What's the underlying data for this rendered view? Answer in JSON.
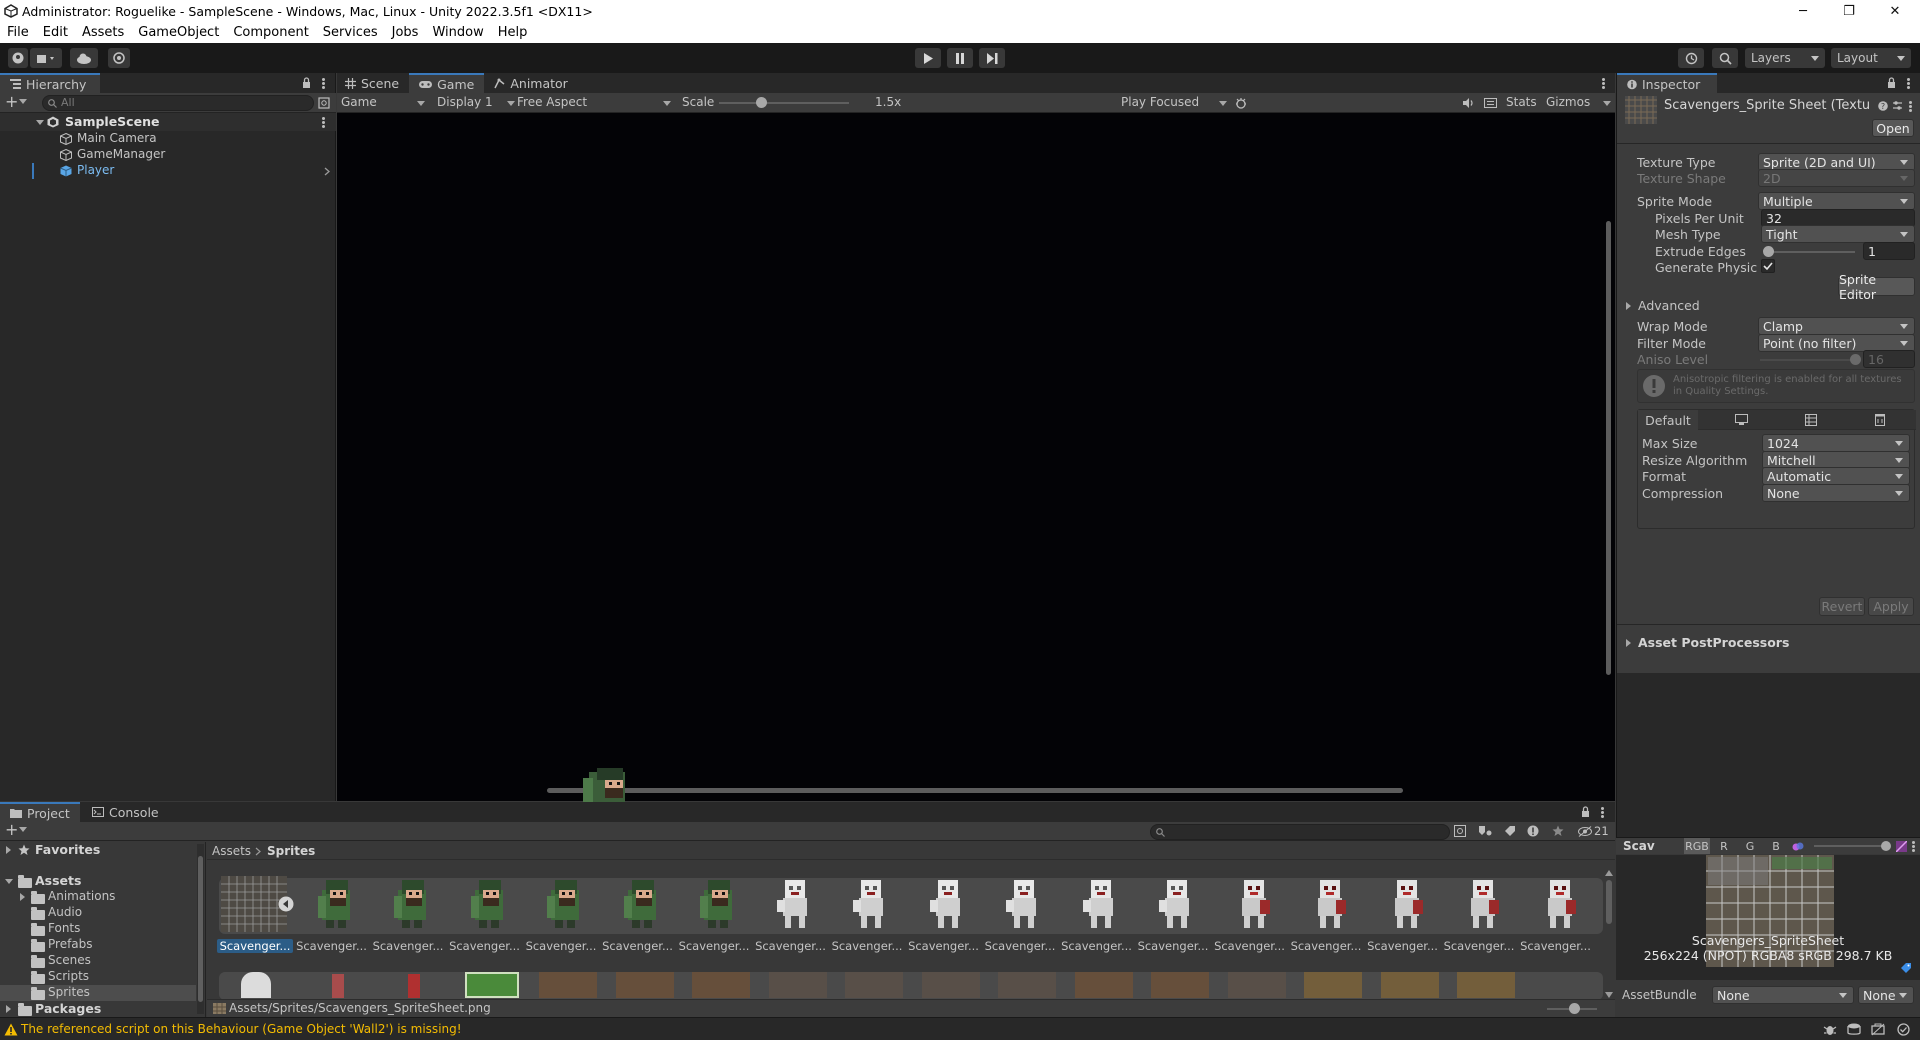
{
  "window": {
    "title": "Administrator: Roguelike - SampleScene - Windows, Mac, Linux - Unity 2022.3.5f1 <DX11>",
    "minimize": "─",
    "maximize": "❐",
    "close": "✕"
  },
  "menu": [
    "File",
    "Edit",
    "Assets",
    "GameObject",
    "Component",
    "Services",
    "Jobs",
    "Window",
    "Help"
  ],
  "toolbar": {
    "layers_label": "Layers",
    "layout_label": "Layout"
  },
  "hierarchy": {
    "tab": "Hierarchy",
    "search_placeholder": "All",
    "scene": "SampleScene",
    "items": [
      "Main Camera",
      "GameManager",
      "Player"
    ]
  },
  "game_view": {
    "tabs": [
      "Scene",
      "Game",
      "Animator"
    ],
    "game_dropdown": "Game",
    "display": "Display 1",
    "aspect": "Free Aspect",
    "scale_label": "Scale",
    "scale_value": "1.5x",
    "play_mode": "Play Focused",
    "stats": "Stats",
    "gizmos": "Gizmos"
  },
  "inspector": {
    "tab": "Inspector",
    "asset_title": "Scavengers_Sprite Sheet (Textu",
    "open_button": "Open",
    "texture_type_label": "Texture Type",
    "texture_type": "Sprite (2D and UI)",
    "texture_shape_label": "Texture Shape",
    "texture_shape": "2D",
    "sprite_mode_label": "Sprite Mode",
    "sprite_mode": "Multiple",
    "ppu_label": "Pixels Per Unit",
    "ppu": "32",
    "mesh_type_label": "Mesh Type",
    "mesh_type": "Tight",
    "extrude_label": "Extrude Edges",
    "extrude": "1",
    "gen_physics_label": "Generate Physics S",
    "sprite_editor": "Sprite Editor",
    "advanced": "Advanced",
    "wrap_label": "Wrap Mode",
    "wrap": "Clamp",
    "filter_label": "Filter Mode",
    "filter": "Point (no filter)",
    "aniso_label": "Aniso Level",
    "aniso": "16",
    "aniso_note": "Anisotropic filtering is enabled for all textures in Quality Settings.",
    "platform_default": "Default",
    "max_size_label": "Max Size",
    "max_size": "1024",
    "resize_label": "Resize Algorithm",
    "resize": "Mitchell",
    "format_label": "Format",
    "format": "Automatic",
    "compression_label": "Compression",
    "compression": "None",
    "revert": "Revert",
    "apply": "Apply",
    "postprocessors": "Asset PostProcessors"
  },
  "preview": {
    "name": "Scav",
    "channels": [
      "RGB",
      "R",
      "G",
      "B"
    ],
    "caption1": "Scavengers_SpriteSheet",
    "caption2": "256x224 (NPOT)  RGBA8 sRGB  298.7 KB",
    "assetbundle_label": "AssetBundle",
    "assetbundle": "None",
    "variant": "None"
  },
  "project": {
    "tabs": [
      "Project",
      "Console"
    ],
    "hidden_count": "21",
    "favorites": "Favorites",
    "assets": "Assets",
    "folders": [
      "Animations",
      "Audio",
      "Fonts",
      "Prefabs",
      "Scenes",
      "Scripts",
      "Sprites"
    ],
    "packages": "Packages",
    "breadcrumb": [
      "Assets",
      "Sprites"
    ],
    "selected_label": "Scavenger...",
    "sprite_label": "Scavenger...",
    "path": "Assets/Sprites/Scavengers_SpriteSheet.png"
  },
  "status": {
    "message": "The referenced script on this Behaviour (Game Object 'Wall2') is missing!"
  },
  "colors": {
    "accent": "#3a79bb",
    "warning": "#f4bc02",
    "selection": "#2c5d87"
  }
}
